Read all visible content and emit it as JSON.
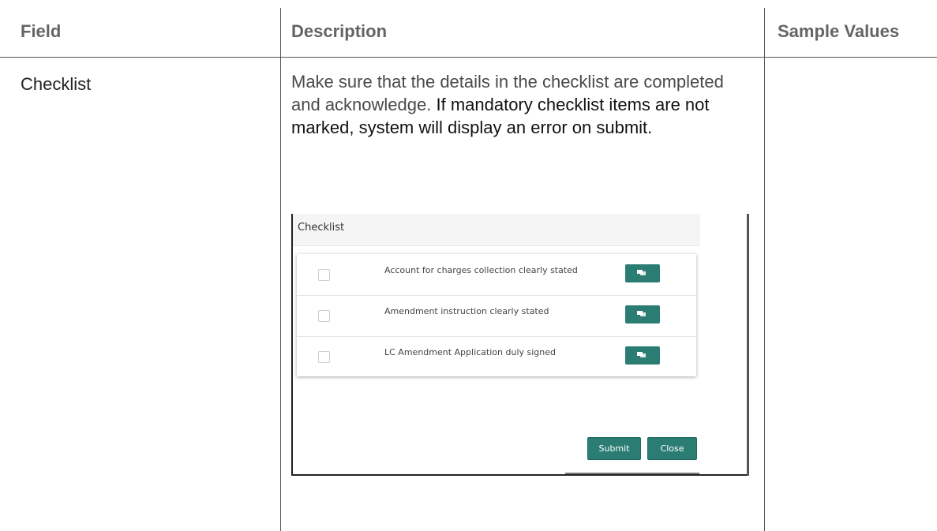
{
  "table": {
    "headers": {
      "field": "Field",
      "description": "Description",
      "sample_values": "Sample Values"
    },
    "row": {
      "field": "Checklist",
      "description_part1": "Make sure that the details in the checklist are completed and acknowledge.",
      "description_part2": "If mandatory checklist items are not marked, system will display an error on submit."
    }
  },
  "checklist_screenshot": {
    "title": "Checklist",
    "items": [
      {
        "label": "Account for charges collection clearly stated",
        "checked": false
      },
      {
        "label": "Amendment instruction clearly stated",
        "checked": false
      },
      {
        "label": "LC Amendment Application duly signed",
        "checked": false
      }
    ],
    "submit_label": "Submit",
    "close_label": "Close",
    "comment_icon": "comment-icon",
    "accent_color": "#2b7d74"
  }
}
